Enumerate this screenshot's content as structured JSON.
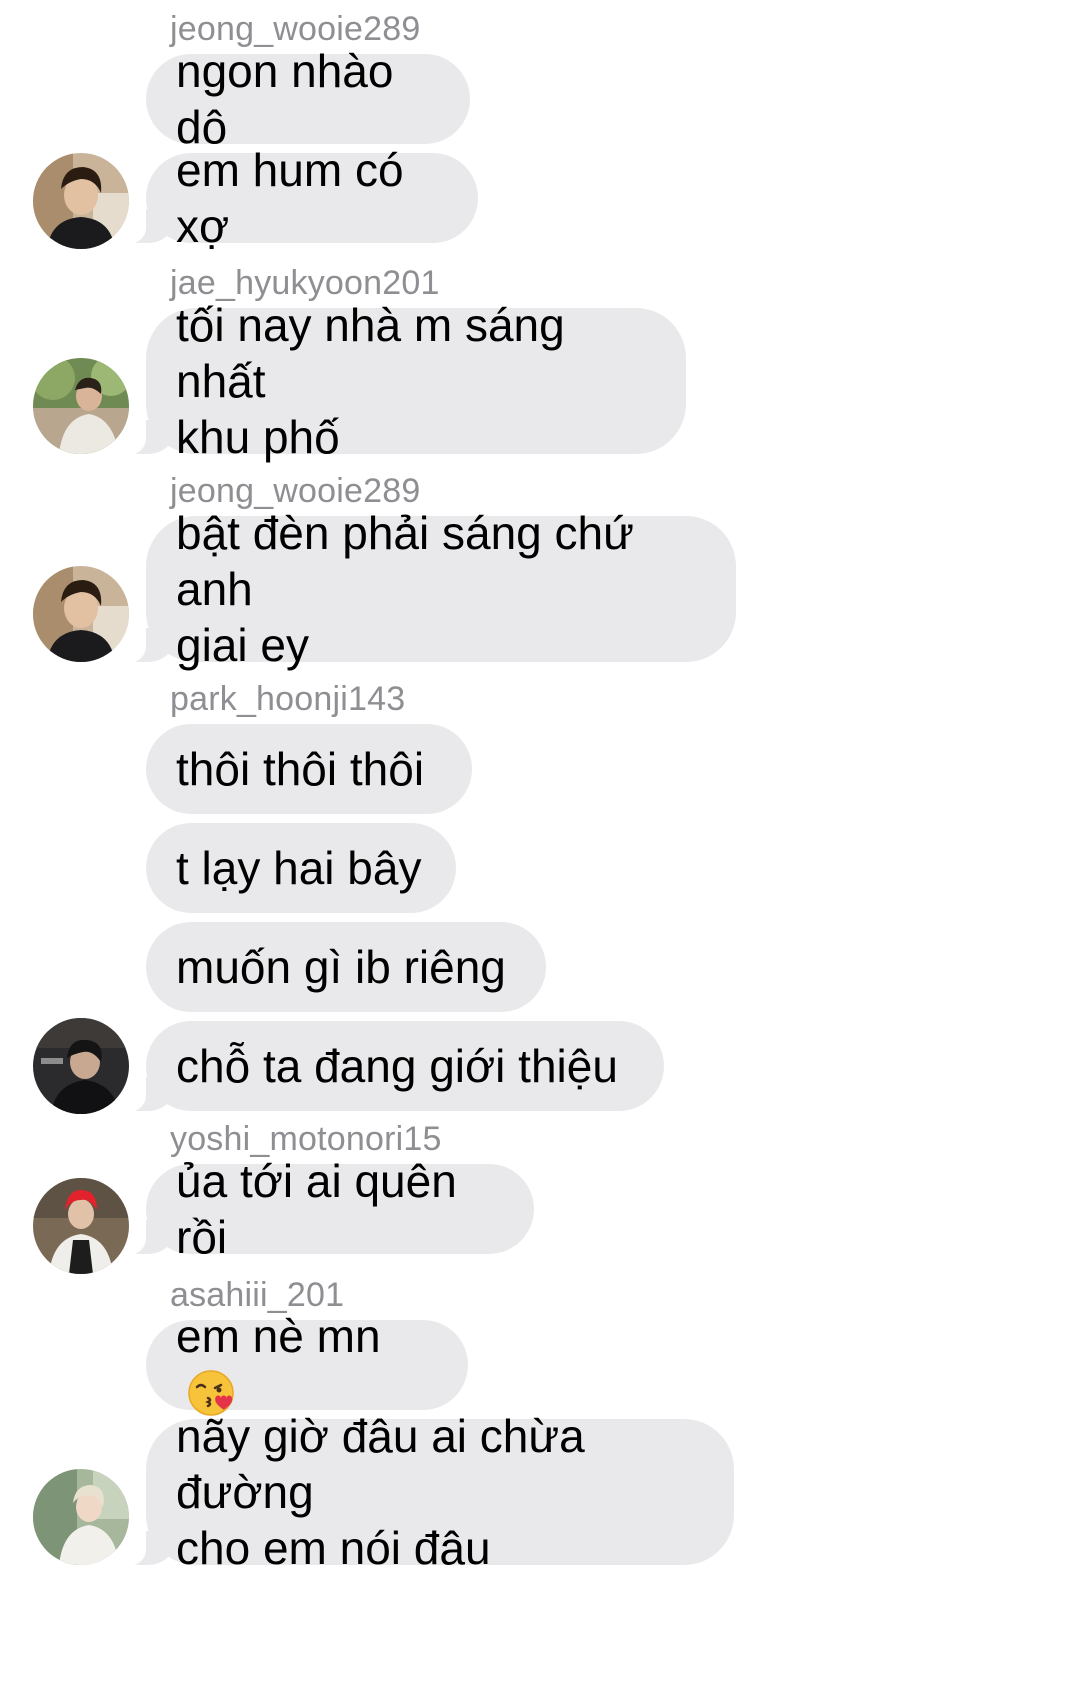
{
  "colors": {
    "bubble": "#e9e9eb",
    "sender": "#8e8e93",
    "text": "#000000",
    "background": "#ffffff"
  },
  "messages": [
    {
      "sender": "jeong_wooie289",
      "text": "ngon nhào dô"
    },
    {
      "text": "em hum có xợ",
      "avatar": "jeong-wooie-avatar"
    },
    {
      "sender": "jae_hyukyoon201",
      "text": "tối nay nhà m sáng nhất\nkhu phố",
      "avatar": "jae-hyukyoon-avatar"
    },
    {
      "sender": "jeong_wooie289",
      "text": "bật đèn phải sáng chứ anh\ngiai ey",
      "avatar": "jeong-wooie-avatar"
    },
    {
      "sender": "park_hoonji143",
      "text": "thôi thôi thôi"
    },
    {
      "text": "t lạy hai bây"
    },
    {
      "text": "muốn gì ib riêng"
    },
    {
      "text": "chỗ ta đang giới thiệu",
      "avatar": "park-hoonji-avatar"
    },
    {
      "sender": "yoshi_motonori15",
      "text": "ủa tới ai quên rồi",
      "avatar": "yoshi-motonori-avatar"
    },
    {
      "sender": "asahiii_201",
      "text": "em nè mn",
      "emoji": "face-blowing-kiss-icon"
    },
    {
      "text": "nãy giờ đâu ai chừa đường\ncho em nói đâu",
      "avatar": "asahiii-avatar"
    }
  ]
}
